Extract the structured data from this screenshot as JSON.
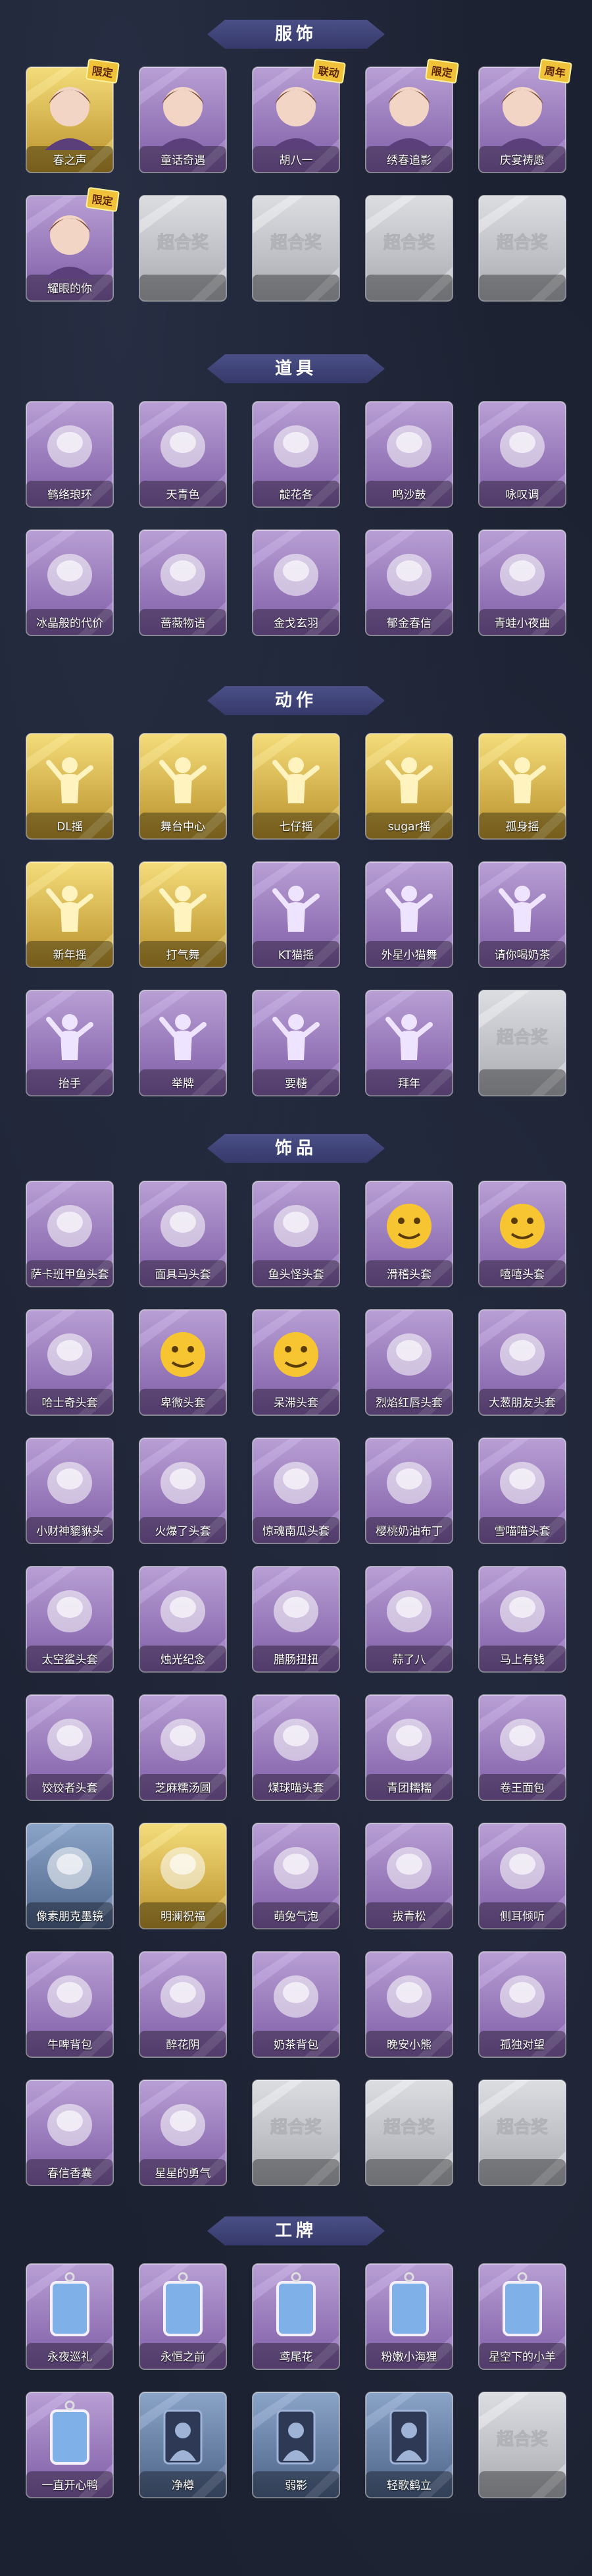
{
  "sections": [
    {
      "title": "服饰",
      "items": [
        {
          "label": "春之声",
          "frame": "gold",
          "icon": "portrait-blonde-icon",
          "badge": "限定"
        },
        {
          "label": "童话奇遇",
          "frame": "purple",
          "icon": "portrait-red-hair-icon"
        },
        {
          "label": "胡八一",
          "frame": "purple",
          "icon": "portrait-crossover-icon",
          "badge": "联动"
        },
        {
          "label": "绣春追影",
          "frame": "purple",
          "icon": "portrait-swordsman-icon",
          "badge": "限定"
        },
        {
          "label": "庆宴祷愿",
          "frame": "purple",
          "icon": "portrait-celebration-icon",
          "badge": "周年"
        },
        {
          "label": "耀眼的你",
          "frame": "purple",
          "icon": "portrait-hat-girl-icon",
          "badge": "限定"
        },
        {
          "label": "超合奖",
          "frame": "empty"
        },
        {
          "label": "超合奖",
          "frame": "empty"
        },
        {
          "label": "超合奖",
          "frame": "empty"
        },
        {
          "label": "超合奖",
          "frame": "empty"
        }
      ]
    },
    {
      "title": "道具",
      "items": [
        {
          "label": "鹤络琅环",
          "frame": "purple",
          "icon": "staff-icon"
        },
        {
          "label": "天青色",
          "frame": "purple",
          "icon": "blue-wand-icon"
        },
        {
          "label": "靛花各",
          "frame": "purple",
          "icon": "horns-icon"
        },
        {
          "label": "鸣沙鼓",
          "frame": "purple",
          "icon": "drum-icon"
        },
        {
          "label": "咏叹调",
          "frame": "purple",
          "icon": "ornate-staff-icon"
        },
        {
          "label": "冰晶般的代价",
          "frame": "purple",
          "icon": "ice-flower-icon"
        },
        {
          "label": "蔷薇物语",
          "frame": "purple",
          "icon": "first-aid-kit-icon"
        },
        {
          "label": "金戈玄羽",
          "frame": "purple",
          "icon": "lantern-icon"
        },
        {
          "label": "郁金春信",
          "frame": "purple",
          "icon": "fan-icon"
        },
        {
          "label": "青蛙小夜曲",
          "frame": "purple",
          "icon": "frog-icon"
        }
      ]
    },
    {
      "title": "动作",
      "items": [
        {
          "label": "DL摇",
          "frame": "gold",
          "icon": "dance-pose-icon"
        },
        {
          "label": "舞台中心",
          "frame": "gold",
          "icon": "dance-pose-icon"
        },
        {
          "label": "七仔摇",
          "frame": "gold",
          "icon": "dance-pose-icon"
        },
        {
          "label": "sugar摇",
          "frame": "gold",
          "icon": "dance-pose-icon"
        },
        {
          "label": "孤身摇",
          "frame": "gold",
          "icon": "dance-pose-icon"
        },
        {
          "label": "新年摇",
          "frame": "gold",
          "icon": "dance-pose-icon"
        },
        {
          "label": "打气舞",
          "frame": "gold",
          "icon": "dance-pose-icon"
        },
        {
          "label": "KT猫摇",
          "frame": "purple",
          "icon": "dance-pose-icon"
        },
        {
          "label": "外星小猫舞",
          "frame": "purple",
          "icon": "dance-pose-icon"
        },
        {
          "label": "请你喝奶茶",
          "frame": "purple",
          "icon": "dance-pose-icon"
        },
        {
          "label": "抬手",
          "frame": "purple",
          "icon": "gesture-pose-icon"
        },
        {
          "label": "举牌",
          "frame": "purple",
          "icon": "gesture-pose-icon"
        },
        {
          "label": "要糖",
          "frame": "purple",
          "icon": "gesture-pose-icon"
        },
        {
          "label": "拜年",
          "frame": "purple",
          "icon": "gesture-pose-icon"
        },
        {
          "label": "超合奖",
          "frame": "empty"
        }
      ]
    },
    {
      "title": "饰品",
      "items": [
        {
          "label": "萨卡班甲鱼头套",
          "frame": "purple",
          "icon": "fish-head-icon"
        },
        {
          "label": "面具马头套",
          "frame": "purple",
          "icon": "horse-head-icon"
        },
        {
          "label": "鱼头怪头套",
          "frame": "purple",
          "icon": "green-fish-icon"
        },
        {
          "label": "滑稽头套",
          "frame": "purple",
          "icon": "smirk-face-icon"
        },
        {
          "label": "嘻嘻头套",
          "frame": "purple",
          "icon": "grin-face-icon"
        },
        {
          "label": "哈士奇头套",
          "frame": "purple",
          "icon": "husky-icon"
        },
        {
          "label": "卑微头套",
          "frame": "purple",
          "icon": "shy-face-icon"
        },
        {
          "label": "呆滞头套",
          "frame": "purple",
          "icon": "stare-face-icon"
        },
        {
          "label": "烈焰红唇头套",
          "frame": "purple",
          "icon": "pikachu-icon"
        },
        {
          "label": "大葱朋友头套",
          "frame": "purple",
          "icon": "scallion-icon"
        },
        {
          "label": "小财神貔貅头",
          "frame": "purple",
          "icon": "pixiu-icon"
        },
        {
          "label": "火爆了头套",
          "frame": "purple",
          "icon": "fire-icon"
        },
        {
          "label": "惊魂南瓜头套",
          "frame": "purple",
          "icon": "pumpkin-icon"
        },
        {
          "label": "樱桃奶油布丁",
          "frame": "purple",
          "icon": "pudding-icon"
        },
        {
          "label": "雪喵喵头套",
          "frame": "purple",
          "icon": "snow-cat-icon"
        },
        {
          "label": "太空鲨头套",
          "frame": "purple",
          "icon": "shark-icon"
        },
        {
          "label": "烛光纪念",
          "frame": "purple",
          "icon": "candle-icon"
        },
        {
          "label": "腊肠扭扭",
          "frame": "purple",
          "icon": "dachshund-icon"
        },
        {
          "label": "蒜了八",
          "frame": "purple",
          "icon": "garlic-icon"
        },
        {
          "label": "马上有钱",
          "frame": "purple",
          "icon": "horse-toy-icon"
        },
        {
          "label": "饺饺者头套",
          "frame": "purple",
          "icon": "dumpling-icon"
        },
        {
          "label": "芝麻糯汤圆",
          "frame": "purple",
          "icon": "tangyuan-icon"
        },
        {
          "label": "煤球喵头套",
          "frame": "purple",
          "icon": "black-cat-icon"
        },
        {
          "label": "青团糯糯",
          "frame": "purple",
          "icon": "qingtuan-icon"
        },
        {
          "label": "卷王面包",
          "frame": "purple",
          "icon": "bread-icon"
        },
        {
          "label": "像素朋克墨镜",
          "frame": "blue",
          "icon": "pixel-sunglasses-icon"
        },
        {
          "label": "明澜祝福",
          "frame": "gold",
          "icon": "halo-icon"
        },
        {
          "label": "萌兔气泡",
          "frame": "purple",
          "icon": "bunny-bubble-icon"
        },
        {
          "label": "拔青松",
          "frame": "purple",
          "icon": "pine-tree-icon"
        },
        {
          "label": "侧耳倾听",
          "frame": "purple",
          "icon": "wreath-icon"
        },
        {
          "label": "牛啤背包",
          "frame": "purple",
          "icon": "cow-backpack-icon"
        },
        {
          "label": "醉花阴",
          "frame": "purple",
          "icon": "hairpin-icon"
        },
        {
          "label": "奶茶背包",
          "frame": "purple",
          "icon": "milk-tea-icon"
        },
        {
          "label": "晚安小熊",
          "frame": "purple",
          "icon": "bear-icon"
        },
        {
          "label": "孤独对望",
          "frame": "purple",
          "icon": "pendant-icon"
        },
        {
          "label": "春信香囊",
          "frame": "purple",
          "icon": "sachet-icon"
        },
        {
          "label": "星星的勇气",
          "frame": "purple",
          "icon": "star-necklace-icon"
        },
        {
          "label": "超合奖",
          "frame": "empty"
        },
        {
          "label": "超合奖",
          "frame": "empty"
        },
        {
          "label": "超合奖",
          "frame": "empty"
        }
      ]
    },
    {
      "title": "工牌",
      "items": [
        {
          "label": "永夜巡礼",
          "frame": "purple",
          "icon": "badge-blue-icon"
        },
        {
          "label": "永恒之前",
          "frame": "purple",
          "icon": "badge-ornate-icon"
        },
        {
          "label": "鸢尾花",
          "frame": "purple",
          "icon": "badge-iris-icon"
        },
        {
          "label": "粉嫩小海狸",
          "frame": "purple",
          "icon": "badge-pink-icon"
        },
        {
          "label": "星空下的小羊",
          "frame": "purple",
          "icon": "badge-star-icon"
        },
        {
          "label": "一直开心鸭",
          "frame": "purple",
          "icon": "badge-duck-icon"
        },
        {
          "label": "净樽",
          "frame": "blue",
          "icon": "silhouette-icon"
        },
        {
          "label": "弱影",
          "frame": "blue",
          "icon": "silhouette-icon"
        },
        {
          "label": "轻歌鹤立",
          "frame": "blue",
          "icon": "silhouette-icon"
        },
        {
          "label": "超合奖",
          "frame": "empty"
        }
      ]
    }
  ],
  "colors": {
    "background": "#1c2131",
    "gold": "#d9b33f",
    "purple": "#9a7bb8",
    "blue": "#5f7aa0",
    "empty": "#c4c6cc",
    "title_bar": "#4a4f86"
  }
}
